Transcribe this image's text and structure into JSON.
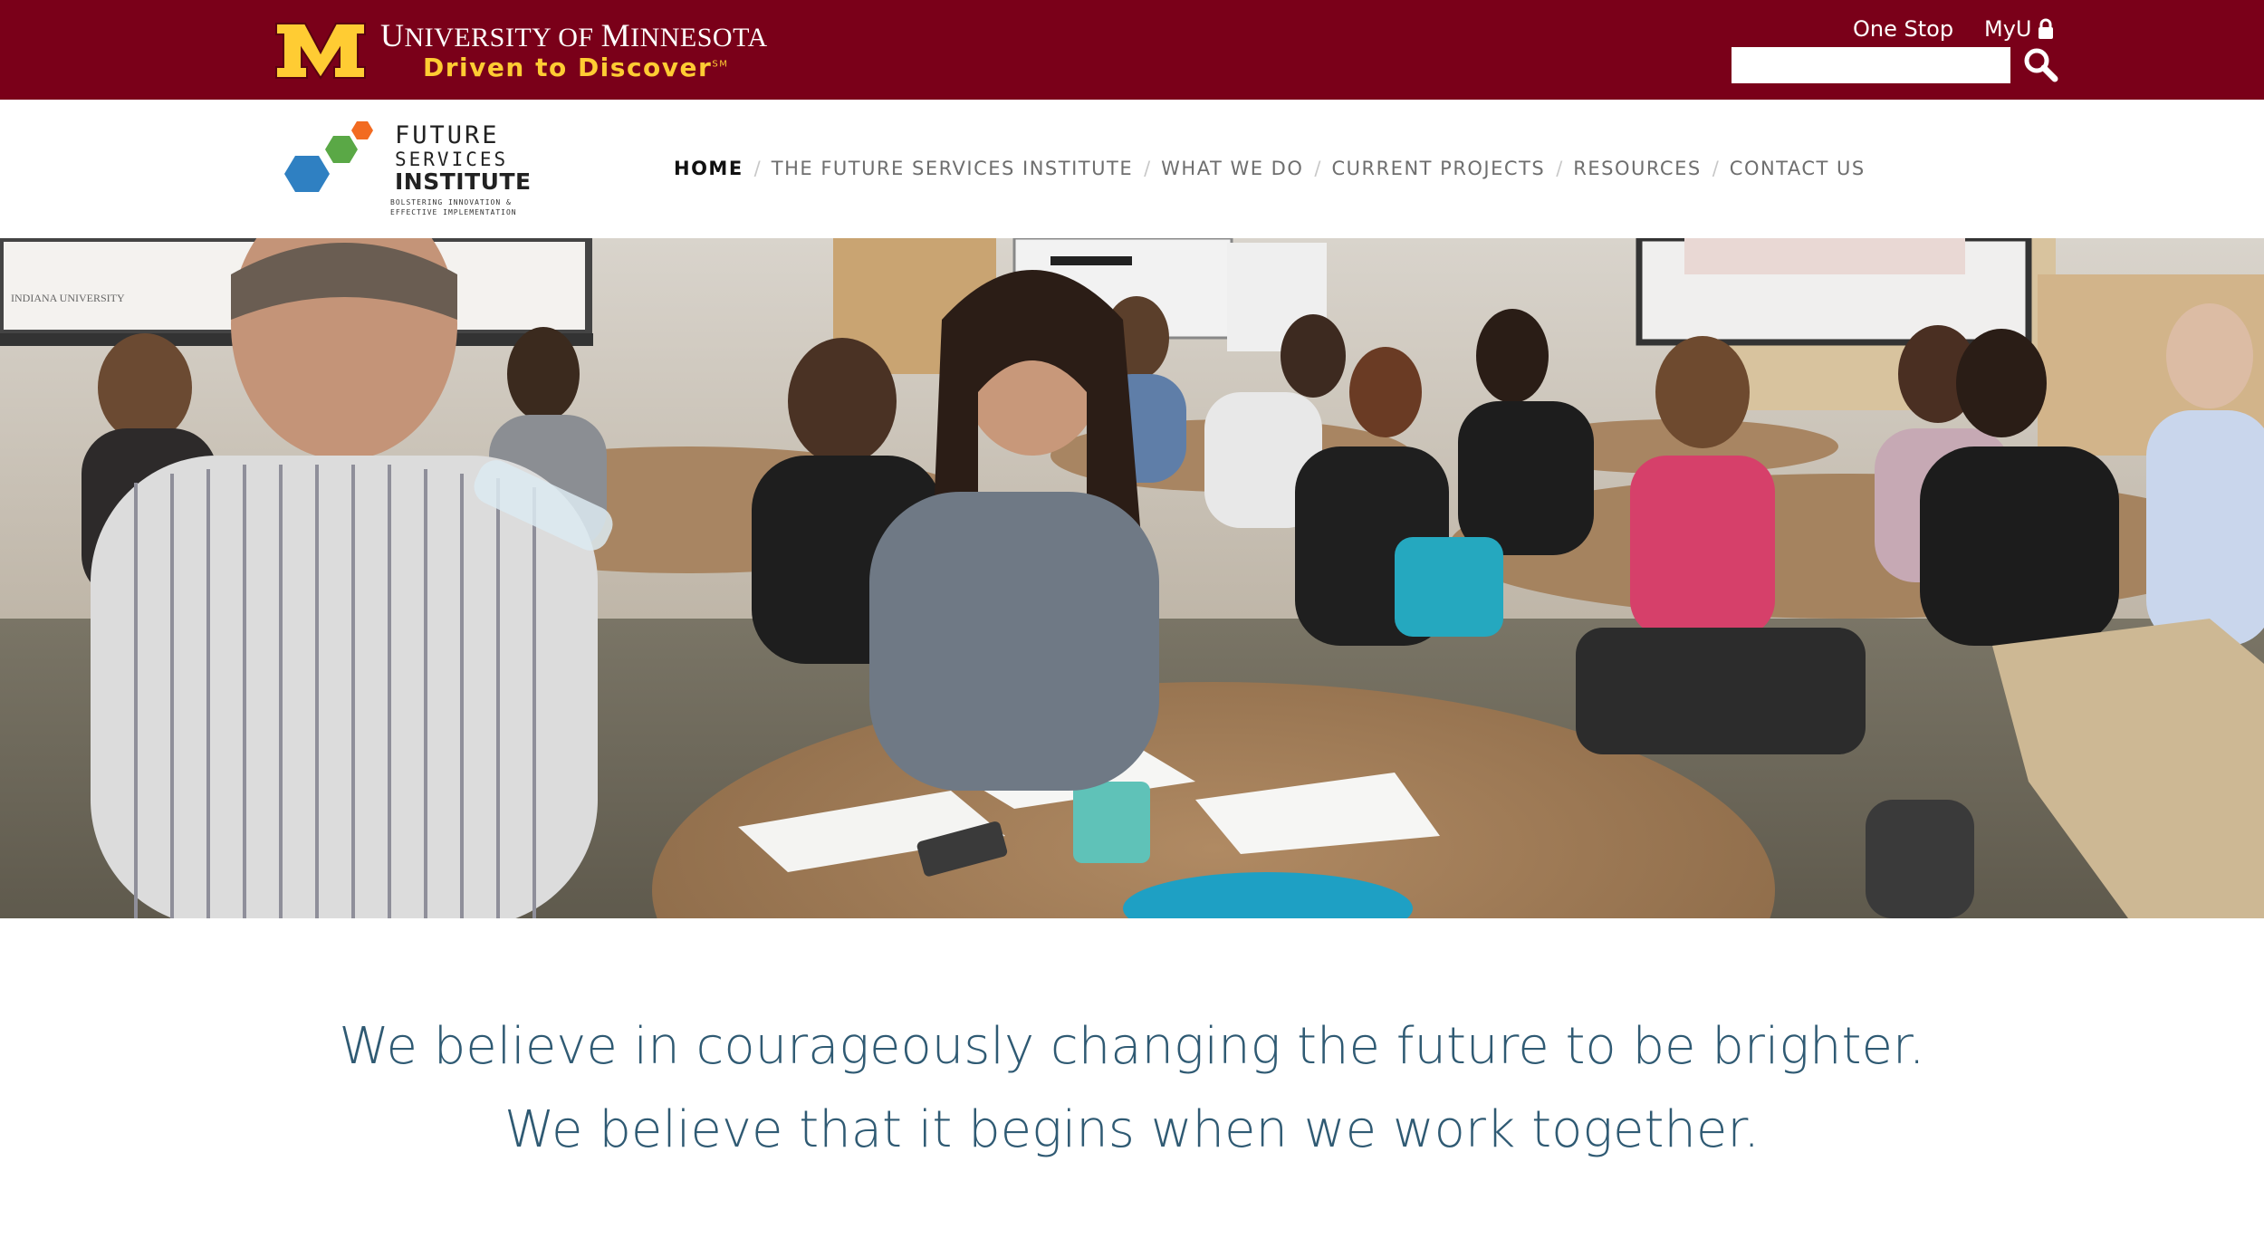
{
  "umn": {
    "name_first": "U",
    "name_rest1": "NIVERSITY OF ",
    "name_m": "M",
    "name_rest2": "INNESOTA",
    "tagline": "Driven to Discover",
    "tagline_mark": "SM",
    "one_stop": "One Stop",
    "myu": "MyU",
    "search_placeholder": ""
  },
  "logo": {
    "line1": "FUTURE",
    "line2": "SERVICES",
    "line3": "INSTITUTE",
    "tagline": "BOLSTERING INNOVATION & EFFECTIVE IMPLEMENTATION"
  },
  "nav": {
    "items": [
      {
        "label": "HOME",
        "active": true
      },
      {
        "label": "THE FUTURE SERVICES INSTITUTE",
        "active": false
      },
      {
        "label": "WHAT WE DO",
        "active": false
      },
      {
        "label": "CURRENT PROJECTS",
        "active": false
      },
      {
        "label": "RESOURCES",
        "active": false
      },
      {
        "label": "CONTACT US",
        "active": false
      }
    ],
    "separator": "/"
  },
  "hero": {
    "screen_text": "INDIANA UNIVERSITY"
  },
  "mission": {
    "line1": "We believe in courageously changing the future to be brighter.",
    "line2": "We believe that it begins when we work together."
  },
  "colors": {
    "maroon": "#7a0019",
    "gold": "#ffcc33",
    "mission_text": "#2f5a73"
  },
  "icons": [
    "umn-m-logo",
    "lock-icon",
    "search-icon",
    "fsi-hexagon-logo"
  ]
}
